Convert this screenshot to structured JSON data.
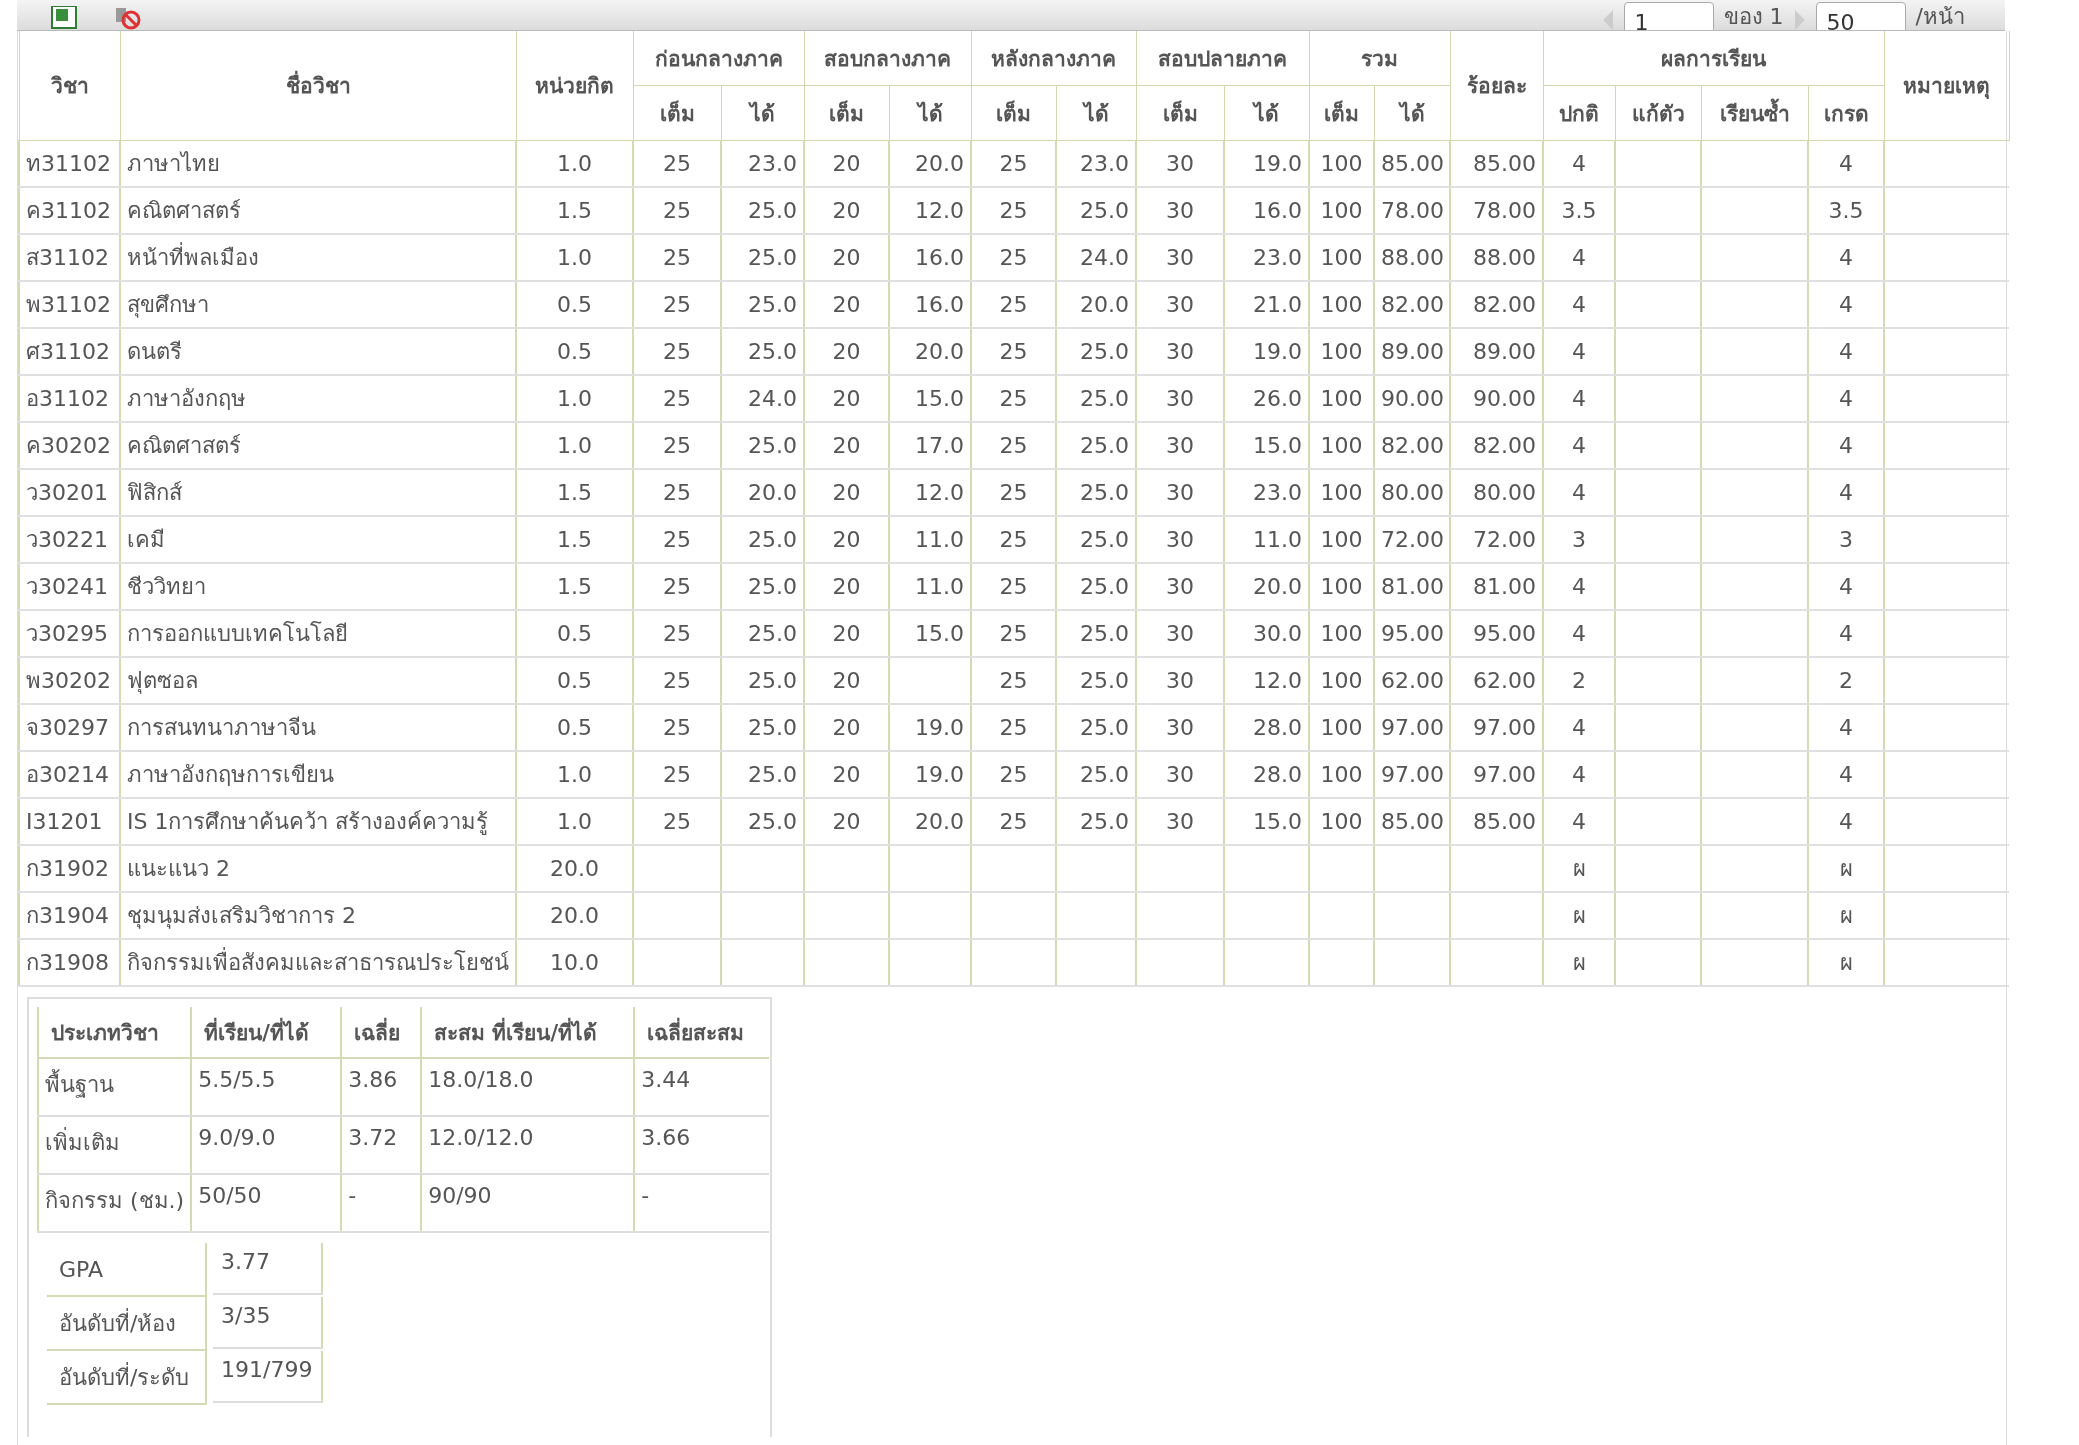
{
  "toolbar": {
    "pager": {
      "page": "1",
      "of_label": "ของ 1",
      "per_page": "50",
      "per_page_label": "/หน้า"
    }
  },
  "grades_table": {
    "columns": [
      "วิชา",
      "ชื่อวิชา",
      "หน่วยกิต"
    ],
    "groups": [
      {
        "label": "ก่อนกลางภาค",
        "subs": [
          "เต็ม",
          "ได้"
        ]
      },
      {
        "label": "สอบกลางภาค",
        "subs": [
          "เต็ม",
          "ได้"
        ]
      },
      {
        "label": "หลังกลางภาค",
        "subs": [
          "เต็ม",
          "ได้"
        ]
      },
      {
        "label": "สอบปลายภาค",
        "subs": [
          "เต็ม",
          "ได้"
        ]
      },
      {
        "label": "รวม",
        "subs": [
          "เต็ม",
          "ได้"
        ]
      }
    ],
    "percent_column": "ร้อยละ",
    "result_group": {
      "label": "ผลการเรียน",
      "subs": [
        "ปกติ",
        "แก้ตัว",
        "เรียนซ้ำ",
        "เกรด"
      ]
    },
    "note_column": "หมายเหตุ",
    "rows": [
      {
        "cells": [
          "ท31102",
          "ภาษาไทย",
          "1.0",
          "25",
          "23.0",
          "20",
          "20.0",
          "25",
          "23.0",
          "30",
          "19.0",
          "100",
          "85.00",
          "85.00",
          "4",
          null,
          null,
          "4"
        ]
      },
      {
        "cells": [
          "ค31102",
          "คณิตศาสตร์",
          "1.5",
          "25",
          "25.0",
          "20",
          "12.0",
          "25",
          "25.0",
          "30",
          "16.0",
          "100",
          "78.00",
          "78.00",
          "3.5",
          null,
          null,
          "3.5"
        ]
      },
      {
        "cells": [
          "ส31102",
          "หน้าที่พลเมือง",
          "1.0",
          "25",
          "25.0",
          "20",
          "16.0",
          "25",
          "24.0",
          "30",
          "23.0",
          "100",
          "88.00",
          "88.00",
          "4",
          null,
          null,
          "4"
        ]
      },
      {
        "cells": [
          "พ31102",
          "สุขศึกษา",
          "0.5",
          "25",
          "25.0",
          "20",
          "16.0",
          "25",
          "20.0",
          "30",
          "21.0",
          "100",
          "82.00",
          "82.00",
          "4",
          null,
          null,
          "4"
        ]
      },
      {
        "cells": [
          "ศ31102",
          "ดนตรี",
          "0.5",
          "25",
          "25.0",
          "20",
          "20.0",
          "25",
          "25.0",
          "30",
          "19.0",
          "100",
          "89.00",
          "89.00",
          "4",
          null,
          null,
          "4"
        ]
      },
      {
        "cells": [
          "อ31102",
          "ภาษาอังกฤษ",
          "1.0",
          "25",
          "24.0",
          "20",
          "15.0",
          "25",
          "25.0",
          "30",
          "26.0",
          "100",
          "90.00",
          "90.00",
          "4",
          null,
          null,
          "4"
        ]
      },
      {
        "cells": [
          "ค30202",
          "คณิตศาสตร์",
          "1.0",
          "25",
          "25.0",
          "20",
          "17.0",
          "25",
          "25.0",
          "30",
          "15.0",
          "100",
          "82.00",
          "82.00",
          "4",
          null,
          null,
          "4"
        ]
      },
      {
        "cells": [
          "ว30201",
          "ฟิสิกส์",
          "1.5",
          "25",
          "20.0",
          "20",
          "12.0",
          "25",
          "25.0",
          "30",
          "23.0",
          "100",
          "80.00",
          "80.00",
          "4",
          null,
          null,
          "4"
        ]
      },
      {
        "cells": [
          "ว30221",
          "เคมี",
          "1.5",
          "25",
          "25.0",
          "20",
          "11.0",
          "25",
          "25.0",
          "30",
          "11.0",
          "100",
          "72.00",
          "72.00",
          "3",
          null,
          null,
          "3"
        ]
      },
      {
        "cells": [
          "ว30241",
          "ชีววิทยา",
          "1.5",
          "25",
          "25.0",
          "20",
          "11.0",
          "25",
          "25.0",
          "30",
          "20.0",
          "100",
          "81.00",
          "81.00",
          "4",
          null,
          null,
          "4"
        ]
      },
      {
        "cells": [
          "ว30295",
          "การออกแบบเทคโนโลยี",
          "0.5",
          "25",
          "25.0",
          "20",
          "15.0",
          "25",
          "25.0",
          "30",
          "30.0",
          "100",
          "95.00",
          "95.00",
          "4",
          null,
          null,
          "4"
        ]
      },
      {
        "cells": [
          "พ30202",
          "ฟุตซอล",
          "0.5",
          "25",
          "25.0",
          "20",
          null,
          "25",
          "25.0",
          "30",
          "12.0",
          "100",
          "62.00",
          "62.00",
          "2",
          null,
          null,
          "2"
        ]
      },
      {
        "cells": [
          "จ30297",
          "การสนทนาภาษาจีน",
          "0.5",
          "25",
          "25.0",
          "20",
          "19.0",
          "25",
          "25.0",
          "30",
          "28.0",
          "100",
          "97.00",
          "97.00",
          "4",
          null,
          null,
          "4"
        ]
      },
      {
        "cells": [
          "อ30214",
          "ภาษาอังกฤษการเขียน",
          "1.0",
          "25",
          "25.0",
          "20",
          "19.0",
          "25",
          "25.0",
          "30",
          "28.0",
          "100",
          "97.00",
          "97.00",
          "4",
          null,
          null,
          "4"
        ]
      },
      {
        "cells": [
          "I31201",
          "IS 1การศึกษาค้นคว้า สร้างองค์ความรู้",
          "1.0",
          "25",
          "25.0",
          "20",
          "20.0",
          "25",
          "25.0",
          "30",
          "15.0",
          "100",
          "85.00",
          "85.00",
          "4",
          null,
          null,
          "4"
        ]
      },
      {
        "cells": [
          "ก31902",
          "แนะแนว 2",
          "20.0",
          null,
          null,
          null,
          null,
          null,
          null,
          null,
          null,
          null,
          null,
          null,
          "ผ",
          null,
          null,
          "ผ"
        ]
      },
      {
        "cells": [
          "ก31904",
          "ชุมนุมส่งเสริมวิชาการ 2",
          "20.0",
          null,
          null,
          null,
          null,
          null,
          null,
          null,
          null,
          null,
          null,
          null,
          "ผ",
          null,
          null,
          "ผ"
        ]
      },
      {
        "cells": [
          "ก31908",
          "กิจกรรมเพื่อสังคมและสาธารณประโยชน์",
          "10.0",
          null,
          null,
          null,
          null,
          null,
          null,
          null,
          null,
          null,
          null,
          null,
          "ผ",
          null,
          null,
          "ผ"
        ]
      }
    ]
  },
  "summary": {
    "columns": [
      "ประเภทวิชา",
      "ที่เรียน/ที่ได้",
      "เฉลี่ย",
      "สะสม ที่เรียน/ที่ได้",
      "เฉลี่ยสะสม"
    ],
    "rows": [
      [
        "พื้นฐาน",
        "5.5/5.5",
        "3.86",
        "18.0/18.0",
        "3.44"
      ],
      [
        "เพิ่มเติม",
        "9.0/9.0",
        "3.72",
        "12.0/12.0",
        "3.66"
      ],
      [
        "กิจกรรม (ชม.)",
        "50/50",
        "-",
        "90/90",
        "-"
      ]
    ],
    "stats": [
      {
        "label": "GPA",
        "value": "3.77"
      },
      {
        "label": "อันดับที่/ห้อง",
        "value": "3/35"
      },
      {
        "label": "อันดับที่/ระดับ",
        "value": "191/799"
      }
    ]
  }
}
